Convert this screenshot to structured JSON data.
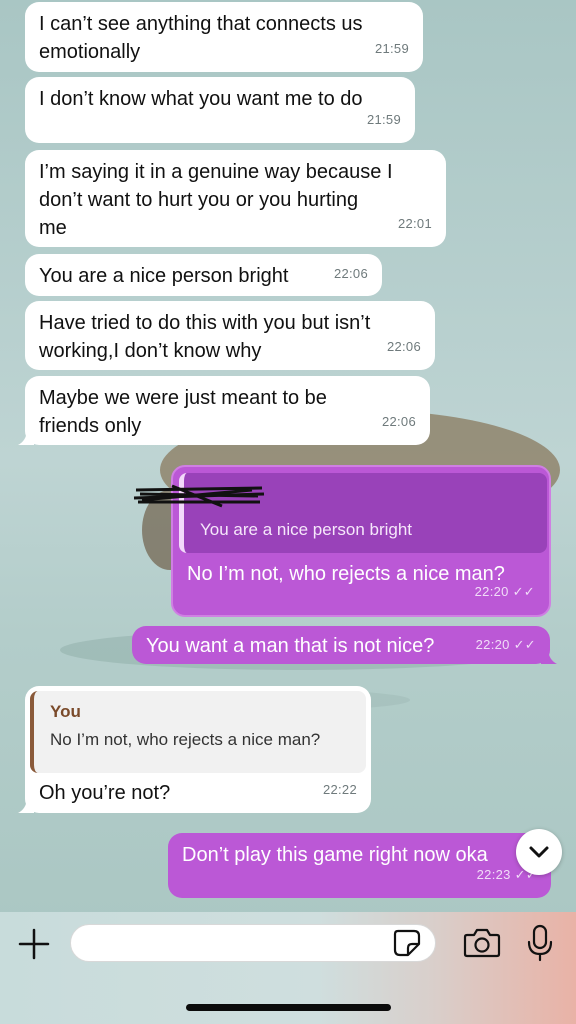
{
  "messages": [
    {
      "direction": "in",
      "text": "I can’t see anything that connects us\nemotionally",
      "time": "21:59"
    },
    {
      "direction": "in",
      "text": "I don’t know what you want me to do",
      "time": "21:59"
    },
    {
      "direction": "in",
      "text": "I’m saying it in a genuine way because I\ndon’t want to hurt you or you hurting\nme",
      "time": "22:01"
    },
    {
      "direction": "in",
      "text": "You are a nice person bright",
      "time": "22:06"
    },
    {
      "direction": "in",
      "text": "Have tried to do this with you but isn’t\nworking,I don’t know why",
      "time": "22:06"
    },
    {
      "direction": "in",
      "text": "Maybe we were just meant to be\nfriends only",
      "time": "22:06"
    },
    {
      "direction": "out",
      "quote": "You are a nice person bright",
      "text": "No I’m not, who rejects a nice man?",
      "time": "22:20 ✓✓"
    },
    {
      "direction": "out",
      "text": "You want a man that is not nice?",
      "time": "22:20 ✓✓"
    },
    {
      "direction": "in",
      "quote_author": "You",
      "quote": "No I’m not, who rejects a nice man?",
      "text": "Oh you’re not?",
      "time": "22:22"
    },
    {
      "direction": "out",
      "text": "Don’t play this game right now oka",
      "time": "22:23 ✓✓"
    }
  ],
  "composer": {
    "placeholder": ""
  },
  "colors": {
    "outgoing": "#bb58d6",
    "incoming": "#ffffff",
    "quote_out": "#9942b9"
  },
  "icons": {
    "add": "plus-icon",
    "sticker": "sticker-icon",
    "camera": "camera-icon",
    "mic": "microphone-icon",
    "scroll": "chevron-down-icon"
  }
}
